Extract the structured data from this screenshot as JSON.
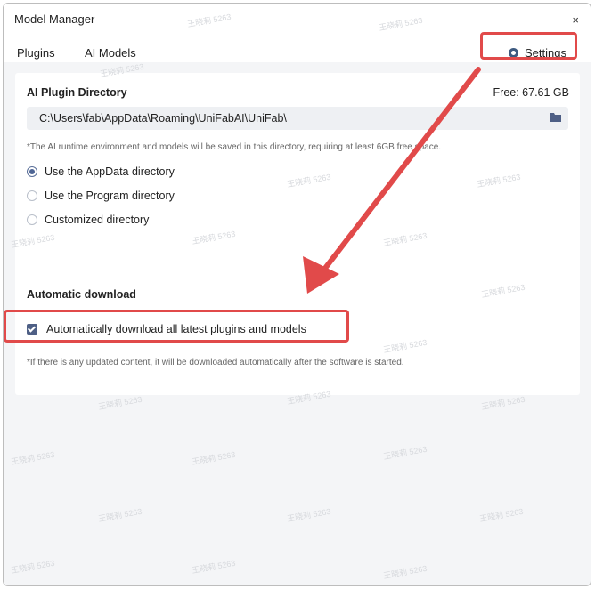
{
  "window": {
    "title": "Model Manager",
    "close_label": "×"
  },
  "tabs": {
    "plugins": "Plugins",
    "ai_models": "AI Models",
    "settings": "Settings"
  },
  "plugin_directory": {
    "heading": "AI Plugin Directory",
    "free_space": "Free: 67.61 GB",
    "path_value": "C:\\Users\\fab\\AppData\\Roaming\\UniFabAI\\UniFab\\",
    "note": "*The AI runtime environment and models will be saved in this directory, requiring at least 6GB free space.",
    "options": [
      {
        "label": "Use the AppData directory",
        "selected": true
      },
      {
        "label": "Use the Program directory",
        "selected": false
      },
      {
        "label": "Customized directory",
        "selected": false
      }
    ]
  },
  "auto_download": {
    "heading": "Automatic download",
    "checkbox_label": "Automatically download all latest plugins and models",
    "checked": true,
    "note": "*If there is any updated content, it will be downloaded automatically after the software is started."
  },
  "watermark_text": "王晓莉 5263",
  "colors": {
    "highlight": "#e14a4a",
    "accent": "#4e5f85",
    "panel_bg": "#f4f5f7"
  },
  "icons": {
    "settings": "gear-icon",
    "folder": "folder-icon",
    "close": "close-icon"
  }
}
